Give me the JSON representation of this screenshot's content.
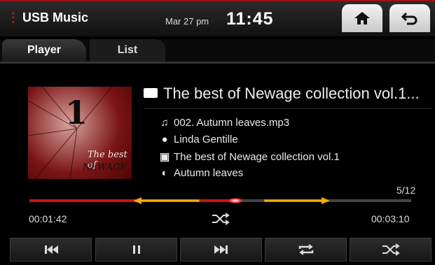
{
  "header": {
    "app_title": "USB Music",
    "date": "Mar 27 pm",
    "time": "11:45",
    "home_icon": "home-icon",
    "back_icon": "back-arrow-icon"
  },
  "tabs": [
    {
      "label": "Player",
      "active": true
    },
    {
      "label": "List",
      "active": false
    }
  ],
  "album_art": {
    "number": "1",
    "text_line1": "The best of",
    "text_line2": "NEWAGE"
  },
  "now_playing": {
    "folder_title": "The best of Newage collection vol.1...",
    "file": "002. Autumn leaves.mp3",
    "artist": "Linda Gentille",
    "album": "The best of Newage collection vol.1",
    "title": "Autumn leaves"
  },
  "playback": {
    "track_count": "5/12",
    "elapsed": "00:01:42",
    "total": "00:03:10",
    "progress_fraction": 0.54
  },
  "controls": [
    {
      "name": "previous-button",
      "icon": "skip-previous-icon"
    },
    {
      "name": "pause-button",
      "icon": "pause-icon"
    },
    {
      "name": "next-button",
      "icon": "skip-next-icon"
    },
    {
      "name": "repeat-button",
      "icon": "repeat-icon"
    },
    {
      "name": "shuffle-button",
      "icon": "shuffle-icon"
    }
  ],
  "colors": {
    "accent": "#d01010",
    "annotation_arrow": "#f5a90f"
  }
}
